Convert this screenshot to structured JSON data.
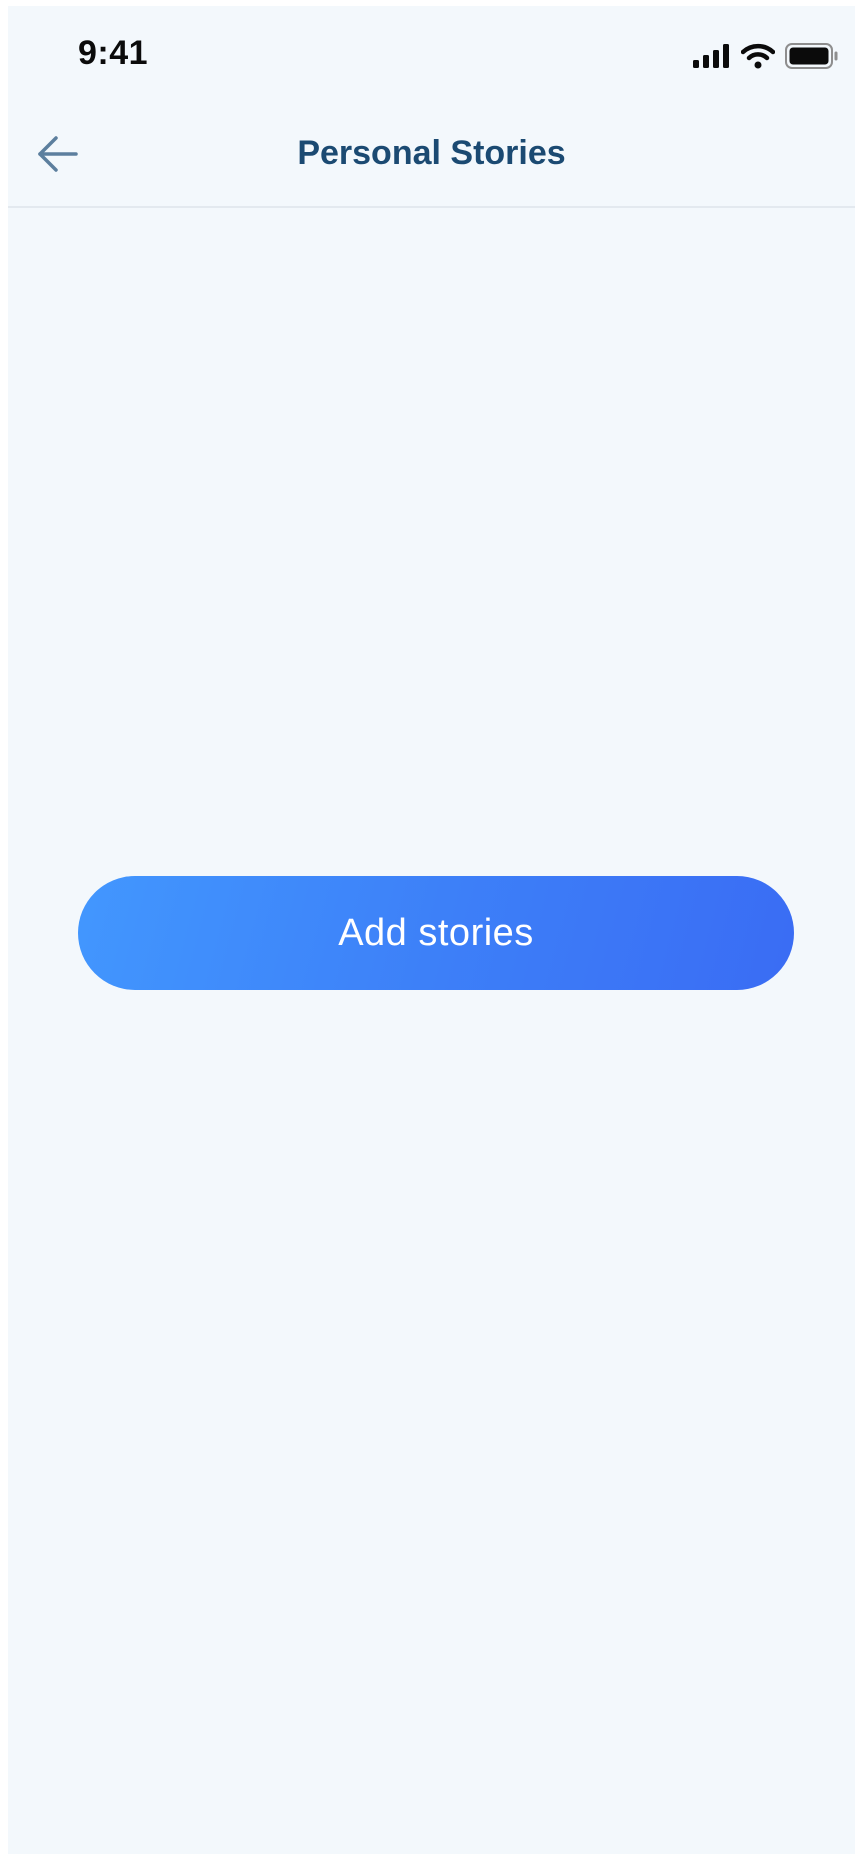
{
  "status_bar": {
    "time": "9:41",
    "icons": [
      "cellular-signal-icon",
      "wifi-icon",
      "battery-icon"
    ]
  },
  "nav": {
    "back_icon": "arrow-left-icon",
    "title": "Personal Stories"
  },
  "main": {
    "add_button_label": "Add stories"
  },
  "colors": {
    "background": "#f3f8fc",
    "title": "#1b4a72",
    "back_icon": "#5c7f9e",
    "button_gradient_start": "#4297fe",
    "button_gradient_end": "#3a6cf4",
    "button_text": "#ffffff"
  }
}
